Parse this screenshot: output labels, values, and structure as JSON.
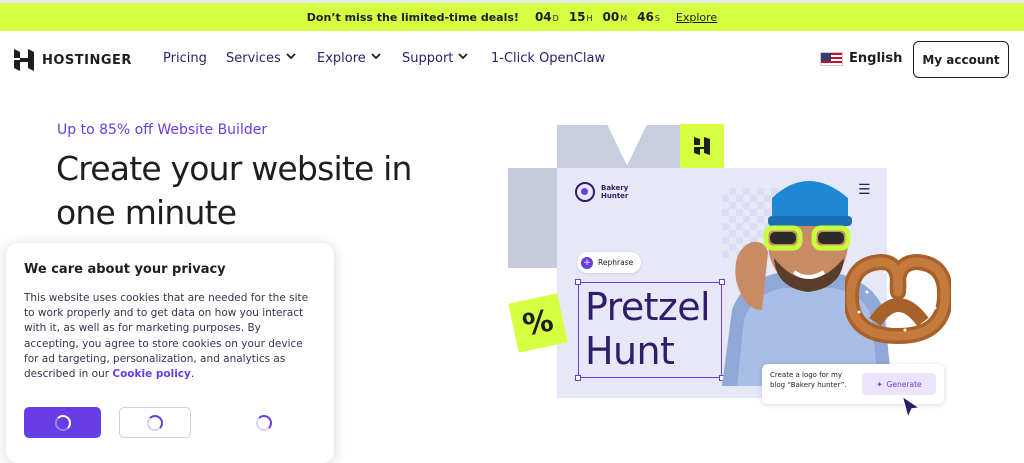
{
  "promo": {
    "text": "Don’t miss the limited-time deals!",
    "countdown": [
      {
        "value": "04",
        "unit": "D"
      },
      {
        "value": "15",
        "unit": "H"
      },
      {
        "value": "00",
        "unit": "M"
      },
      {
        "value": "46",
        "unit": "S"
      }
    ],
    "link": "Explore"
  },
  "nav": {
    "brand": "HOSTINGER",
    "items": [
      {
        "label": "Pricing",
        "dropdown": false
      },
      {
        "label": "Services",
        "dropdown": true
      },
      {
        "label": "Explore",
        "dropdown": true
      },
      {
        "label": "Support",
        "dropdown": true
      },
      {
        "label": "1-Click OpenClaw",
        "dropdown": false
      }
    ],
    "language": "English",
    "account_button": "My account"
  },
  "hero": {
    "kicker": "Up to 85% off Website Builder",
    "title": "Create your website in one minute"
  },
  "cookie": {
    "title": "We care about your privacy",
    "body": "This website uses cookies that are needed for the site to work properly and to get data on how you interact with it, as well as for marketing purposes. By accepting, you agree to store cookies on your device for ad targeting, personalization, and analytics as described in our",
    "link": "Cookie policy",
    "after_link": "."
  },
  "illustration": {
    "brand_line1": "Bakery",
    "brand_line2": "Hunter",
    "rephrase": "Rephrase",
    "percent": "%",
    "headline_line1": "Pretzel",
    "headline_line2": "Hunt",
    "prompt": "Create a logo for my blog “Bakery hunter”.",
    "generate": "Generate"
  },
  "colors": {
    "accent": "#673de6",
    "lime": "#d5ff40",
    "dark": "#1d1e20"
  }
}
